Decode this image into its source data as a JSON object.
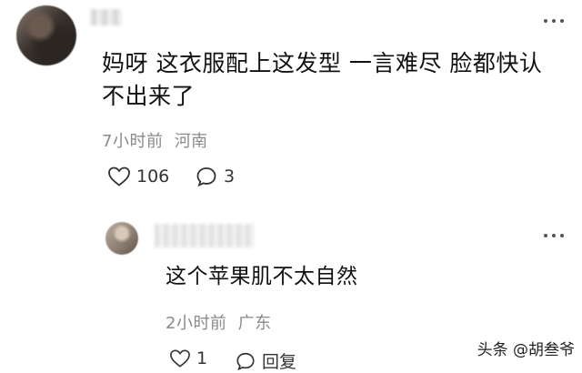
{
  "comment": {
    "text_line1": "妈呀 这衣服配上这发型 一言难尽 脸都快认",
    "text_line2": "不出来了",
    "time": "7小时前",
    "location": "河南",
    "likes": "106",
    "replies": "3"
  },
  "reply": {
    "text": "这个苹果肌不太自然",
    "time": "2小时前",
    "location": "广东",
    "likes": "1",
    "reply_label": "回复"
  },
  "watermark": "头条 @胡叁爷",
  "icons": [
    "more-icon",
    "heart-icon",
    "comment-bubble-icon"
  ]
}
